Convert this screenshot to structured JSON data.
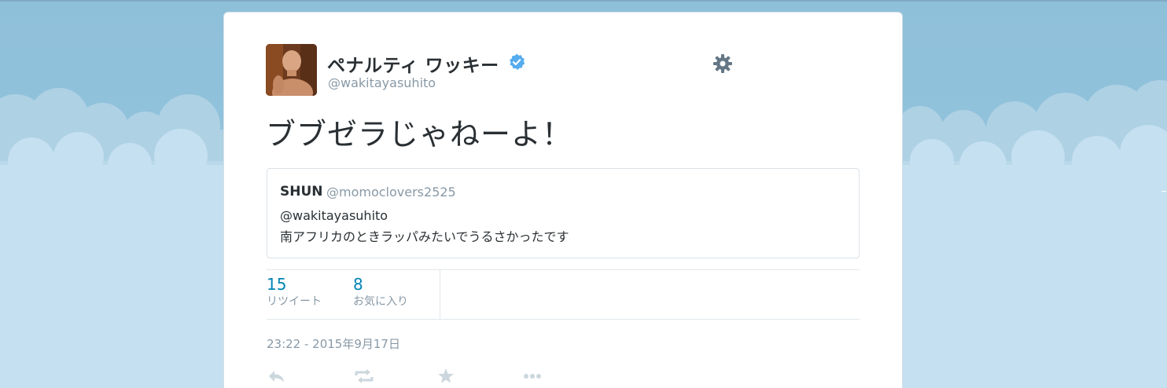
{
  "colors": {
    "background_sky": "#91c2dc",
    "card_background": "#ffffff",
    "text_primary": "#292f33",
    "text_secondary": "#8899a6",
    "link_blue": "#0084b4",
    "verified_blue": "#55acee",
    "icon_gray": "#657786",
    "action_icon_gray": "#ccd6dd"
  },
  "tweet": {
    "user": {
      "display_name": "ペナルティ ワッキー",
      "username": "@wakitayasuhito",
      "verified": true,
      "avatar_icon": "user-avatar"
    },
    "settings_icon": "gear-icon",
    "text": "ブブゼラじゃねーよ！",
    "quoted_tweet": {
      "name": "SHUN",
      "username": "@momoclovers2525",
      "line1": "@wakitayasuhito",
      "line2": "南アフリカのときラッパみたいでうるさかったです"
    },
    "stats": {
      "retweets": {
        "count": "15",
        "label": "リツイート"
      },
      "favorites": {
        "count": "8",
        "label": "お気に入り"
      }
    },
    "timestamp": "23:22 - 2015年9月17日",
    "actions": [
      {
        "name": "reply",
        "icon": "reply-icon"
      },
      {
        "name": "retweet",
        "icon": "retweet-icon"
      },
      {
        "name": "favorite",
        "icon": "star-icon"
      },
      {
        "name": "more",
        "icon": "more-icon"
      }
    ]
  }
}
